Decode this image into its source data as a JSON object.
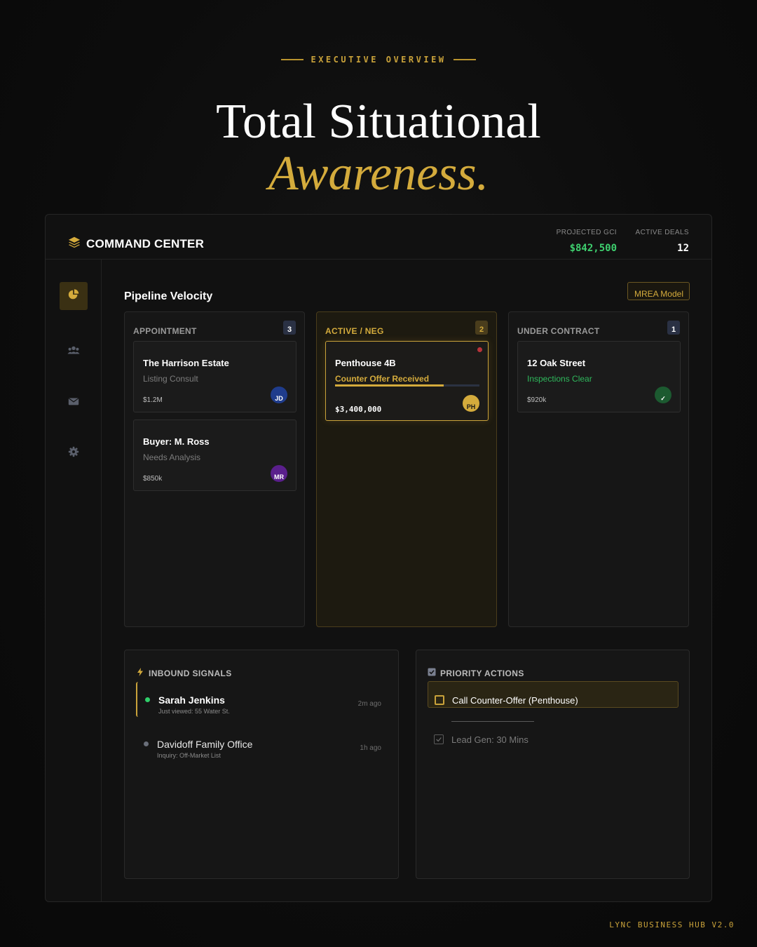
{
  "hero": {
    "eyebrow": "EXECUTIVE OVERVIEW",
    "line1": "Total Situational",
    "line2": "Awareness."
  },
  "header": {
    "brand": "COMMAND CENTER",
    "brand_icon": "layers-icon",
    "stats": [
      {
        "label": "PROJECTED GCI",
        "value": "$842,500"
      },
      {
        "label": "ACTIVE DEALS",
        "value": "12"
      }
    ]
  },
  "sidebar": {
    "items": [
      {
        "icon": "pie-chart-icon",
        "active": true
      },
      {
        "icon": "users-icon",
        "active": false
      },
      {
        "icon": "envelope-icon",
        "active": false
      },
      {
        "icon": "gear-icon",
        "active": false
      }
    ]
  },
  "pipeline": {
    "title": "Pipeline Velocity",
    "model_button": "MREA Model",
    "columns": [
      {
        "name": "APPOINTMENT",
        "count": "3",
        "cards": [
          {
            "title": "The Harrison Estate",
            "subtitle": "Listing Consult",
            "value": "$1.2M",
            "avatar": "JD",
            "avatar_color": "#1f3c8c"
          },
          {
            "title": "Buyer: M. Ross",
            "subtitle": "Needs Analysis",
            "value": "$850k",
            "avatar": "MR",
            "avatar_color": "#5a1f8c"
          }
        ]
      },
      {
        "name": "ACTIVE / NEG",
        "count": "2",
        "cards": [
          {
            "title": "Penthouse 4B",
            "subtitle": "Counter Offer Received",
            "value": "$3,400,000",
            "avatar": "PH",
            "avatar_color": "#d4ab3c",
            "progress": 0.75
          }
        ]
      },
      {
        "name": "UNDER CONTRACT",
        "count": "1",
        "cards": [
          {
            "title": "12 Oak Street",
            "subtitle": "Inspections Clear",
            "value": "$920k",
            "avatar": "✓",
            "avatar_color": "#1c5a30"
          }
        ]
      }
    ]
  },
  "signals": {
    "title": "INBOUND SIGNALS",
    "icon": "lightning-icon",
    "items": [
      {
        "name": "Sarah Jenkins",
        "detail": "Just viewed: 55 Water St.",
        "time": "2m ago",
        "dot_color": "#2fcf6a"
      },
      {
        "name": "Davidoff Family Office",
        "detail": "Inquiry: Off-Market List",
        "time": "1h ago",
        "dot_color": "#6a6f7a"
      }
    ]
  },
  "actions": {
    "title": "PRIORITY ACTIONS",
    "icon": "checkbox-icon",
    "items": [
      {
        "label": "Call Counter-Offer (Penthouse)",
        "done": false
      },
      {
        "label": "Lead Gen: 30 Mins",
        "done": true
      }
    ]
  },
  "footer": "LYNC BUSINESS HUB V2.0",
  "colors": {
    "gold": "#d4ab3c",
    "green": "#3ecf6e",
    "background": "#0c0c0c"
  }
}
